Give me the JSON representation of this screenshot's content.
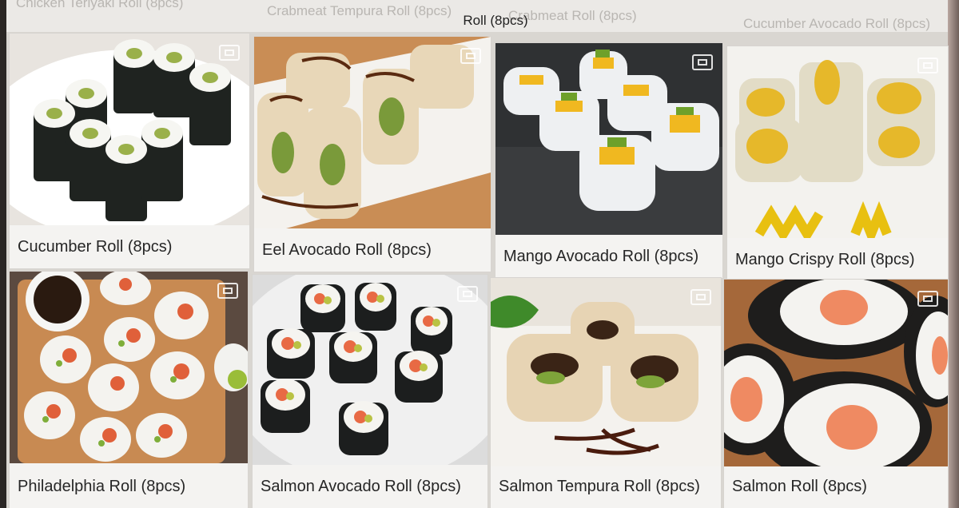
{
  "header": {
    "category_title": "Roll (8pcs)",
    "background_items": [
      "Chicken Teriyaki Roll (8pcs)",
      "Crabmeat Tempura Roll (8pcs)",
      "Crabmeat Roll (8pcs)",
      "Cucumber Avocado Roll (8pcs)"
    ]
  },
  "menu": {
    "items": [
      {
        "name": "Cucumber Roll (8pcs)"
      },
      {
        "name": "Eel Avocado Roll (8pcs)"
      },
      {
        "name": "Mango Avocado Roll (8pcs)"
      },
      {
        "name": "Mango Crispy Roll (8pcs)"
      },
      {
        "name": "Philadelphia Roll (8pcs)"
      },
      {
        "name": "Salmon Avocado Roll (8pcs)"
      },
      {
        "name": "Salmon Tempura Roll (8pcs)"
      },
      {
        "name": "Salmon Roll (8pcs)"
      }
    ]
  },
  "icons": {
    "expand": "expand-icon"
  }
}
